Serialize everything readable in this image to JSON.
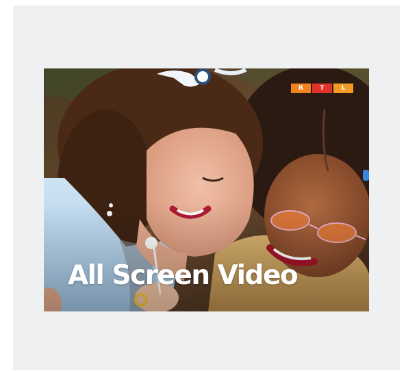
{
  "ad": {
    "headline": "All Screen Video",
    "logo": {
      "letters": [
        "R",
        "T",
        "L"
      ],
      "colors": [
        "#f0831f",
        "#e2332a",
        "#f29a23"
      ]
    },
    "image_description_icon": "photo-two-women-laughing"
  },
  "colors": {
    "panel_background": "#eff0f2",
    "page_background": "#ffffff",
    "headline_color": "#ffffff"
  }
}
